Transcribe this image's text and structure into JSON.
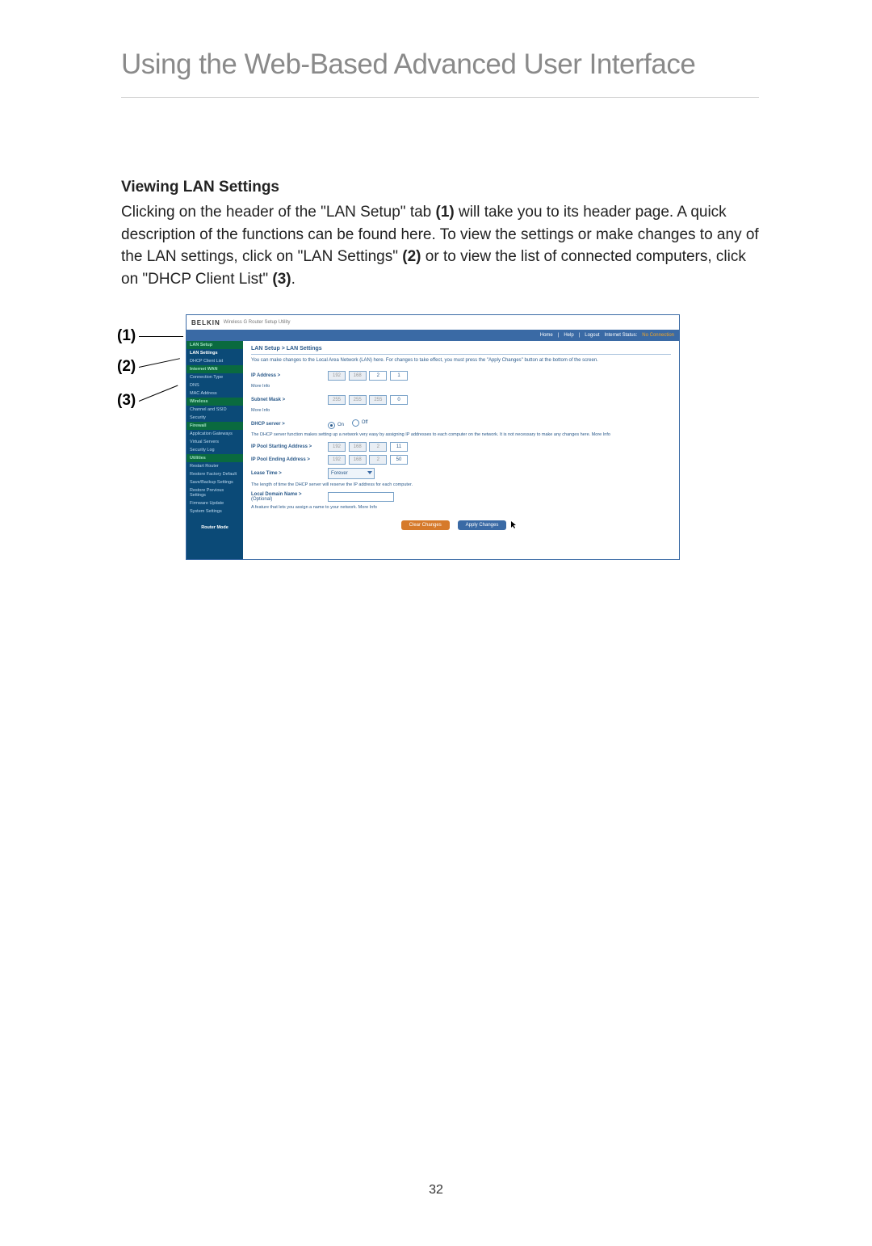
{
  "page": {
    "title": "Using the Web-Based Advanced User Interface",
    "section_heading": "Viewing LAN Settings",
    "body_text_1": "Clicking on the header of the \"LAN Setup\" tab ",
    "ref1": "(1)",
    "body_text_2": " will take you to its header page. A quick description of the functions can be found here. To view the settings or make changes to any of the LAN settings, click on \"LAN Settings\" ",
    "ref2": "(2)",
    "body_text_3": " or to view the list of connected computers, click on \"DHCP Client List\" ",
    "ref3": "(3)",
    "body_text_4": ".",
    "page_number": "32"
  },
  "callouts": {
    "c1": "(1)",
    "c2": "(2)",
    "c3": "(3)"
  },
  "ui": {
    "brand": "BELKIN",
    "brand_sub": "Wireless G Router Setup Utility",
    "topbar": {
      "home": "Home",
      "help": "Help",
      "logout": "Logout",
      "status_label": "Internet Status:",
      "status_value": "No Connection"
    },
    "sidebar": {
      "lan_setup": "LAN Setup",
      "lan_settings": "LAN Settings",
      "dhcp_client": "DHCP Client List",
      "internet_wan": "Internet WAN",
      "conn_type": "Connection Type",
      "dns": "DNS",
      "mac": "MAC Address",
      "wireless": "Wireless",
      "channel_ssid": "Channel and SSID",
      "security": "Security",
      "firewall": "Firewall",
      "app_gw": "Application Gateways",
      "vservers": "Virtual Servers",
      "seclog": "Security Log",
      "utilities": "Utilities",
      "restart": "Restart Router",
      "factory": "Restore Factory Default",
      "savebackup": "Save/Backup Settings",
      "restoreprev": "Restore Previous Settings",
      "firmware": "Firmware Update",
      "system": "System Settings",
      "router_mode": "Router Mode"
    },
    "content": {
      "breadcrumb": "LAN Setup > LAN Settings",
      "intro": "You can make changes to the Local Area Network (LAN) here. For changes to take effect, you must press the \"Apply Changes\" button at the bottom of the screen.",
      "ip_label": "IP Address >",
      "ip": [
        "192",
        "168",
        "2",
        "1"
      ],
      "more_info": "More Info",
      "subnet_label": "Subnet Mask >",
      "subnet": [
        "255",
        "255",
        "255",
        "0"
      ],
      "dhcp_label": "DHCP server >",
      "on": "On",
      "off": "Off",
      "dhcp_desc": "The DHCP server function makes setting up a network very easy by assigning IP addresses to each computer on the network. It is not necessary to make any changes here. More Info",
      "pool_start_label": "IP Pool Starting Address >",
      "pool_start": [
        "192",
        "168",
        "2",
        "11"
      ],
      "pool_end_label": "IP Pool Ending Address >",
      "pool_end": [
        "192",
        "168",
        "2",
        "50"
      ],
      "lease_label": "Lease Time >",
      "lease_value": "Forever",
      "lease_desc": "The length of time the DHCP server will reserve the IP address for each computer.",
      "domain_label": "Local Domain Name >",
      "domain_optional": "(Optional)",
      "domain_desc": "A feature that lets you assign a name to your network. More Info",
      "clear": "Clear Changes",
      "apply": "Apply Changes"
    }
  }
}
